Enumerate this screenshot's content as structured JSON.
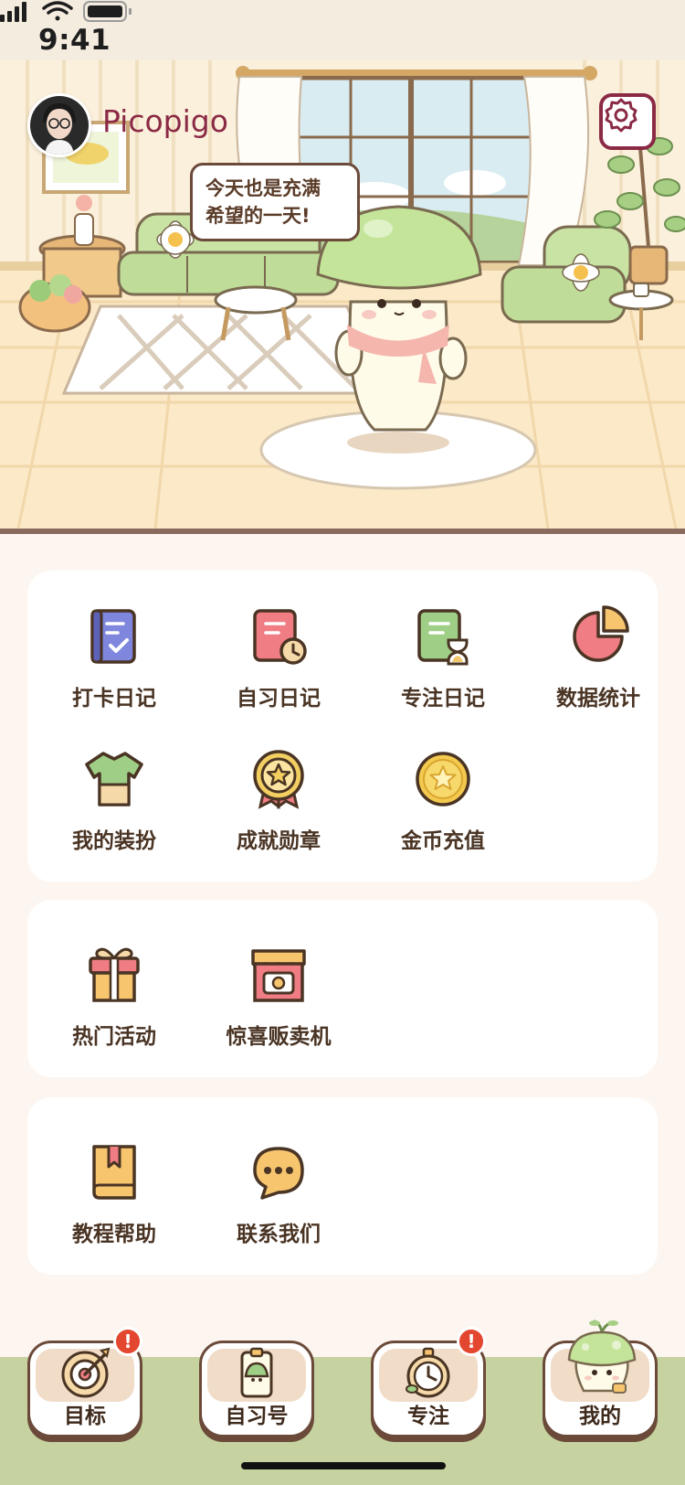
{
  "status_bar": {
    "time": "9:41"
  },
  "profile": {
    "username": "Picopigo"
  },
  "speech": {
    "line1": "今天也是充满",
    "line2": "希望的一天!"
  },
  "colors": {
    "accent": "#8b2a45",
    "background": "#fdf6f0",
    "nav": "#c6d3a0",
    "badge": "#e3472f"
  },
  "grid1": {
    "items": [
      {
        "label": "打卡日记",
        "icon": "check-diary-icon"
      },
      {
        "label": "自习日记",
        "icon": "study-diary-icon"
      },
      {
        "label": "专注日记",
        "icon": "focus-diary-icon"
      },
      {
        "label": "数据统计",
        "icon": "pie-chart-icon"
      },
      {
        "label": "我的装扮",
        "icon": "shirt-icon"
      },
      {
        "label": "成就勋章",
        "icon": "medal-icon"
      },
      {
        "label": "金币充值",
        "icon": "coin-icon"
      }
    ]
  },
  "grid2": {
    "items": [
      {
        "label": "热门活动",
        "icon": "gift-icon"
      },
      {
        "label": "惊喜贩卖机",
        "icon": "vending-machine-icon"
      }
    ]
  },
  "grid3": {
    "items": [
      {
        "label": "教程帮助",
        "icon": "book-icon"
      },
      {
        "label": "联系我们",
        "icon": "chat-icon"
      }
    ]
  },
  "nav": {
    "tabs": [
      {
        "label": "目标",
        "icon": "target-icon",
        "badge": "!"
      },
      {
        "label": "自习号",
        "icon": "id-badge-icon",
        "badge": ""
      },
      {
        "label": "专注",
        "icon": "stopwatch-icon",
        "badge": "!"
      },
      {
        "label": "我的",
        "icon": "mushroom-icon",
        "badge": ""
      }
    ]
  }
}
